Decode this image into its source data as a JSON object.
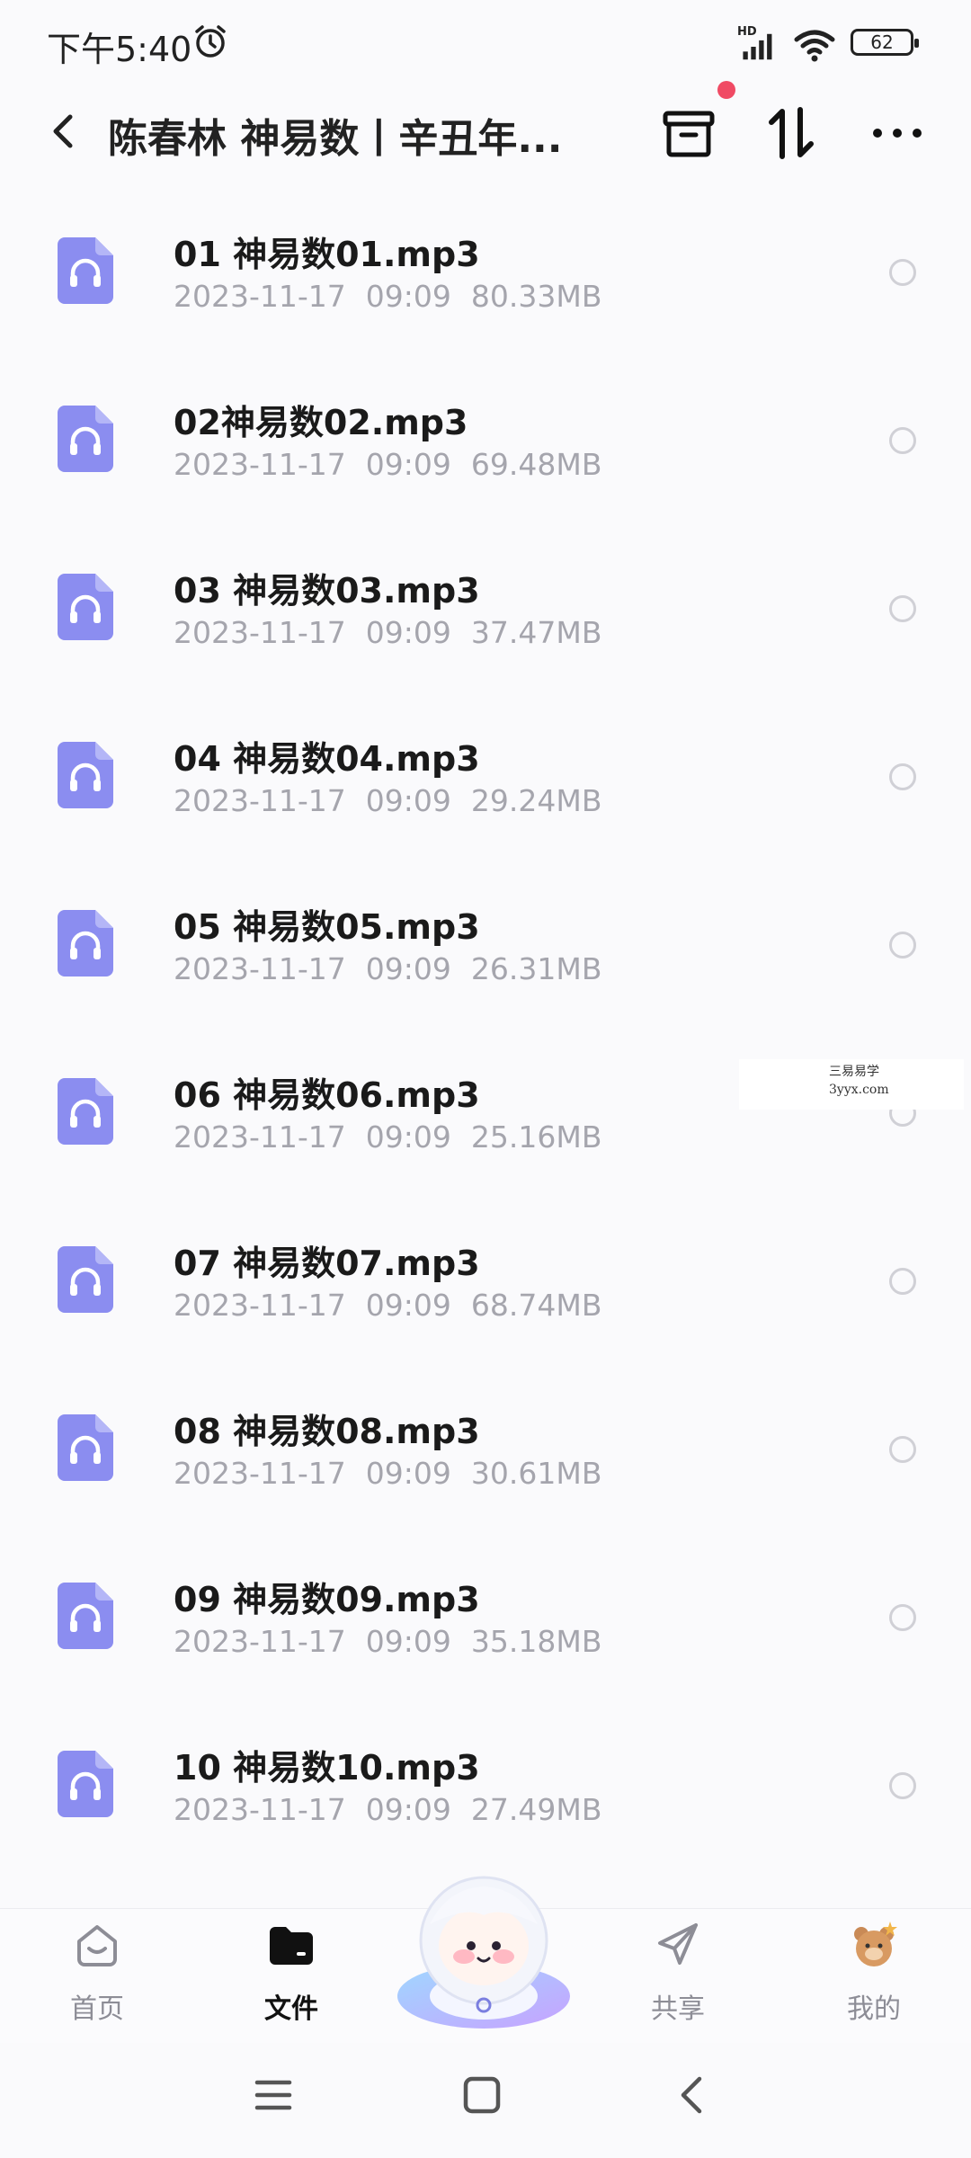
{
  "status": {
    "time": "下午5:40",
    "network": "HD",
    "battery": "62"
  },
  "header": {
    "title": "陈春林 神易数丨辛丑年..."
  },
  "files": [
    {
      "name": "01 神易数01.mp3",
      "date": "2023-11-17",
      "time": "09:09",
      "size": "80.33MB"
    },
    {
      "name": "02神易数02.mp3",
      "date": "2023-11-17",
      "time": "09:09",
      "size": "69.48MB"
    },
    {
      "name": "03 神易数03.mp3",
      "date": "2023-11-17",
      "time": "09:09",
      "size": "37.47MB"
    },
    {
      "name": "04 神易数04.mp3",
      "date": "2023-11-17",
      "time": "09:09",
      "size": "29.24MB"
    },
    {
      "name": "05 神易数05.mp3",
      "date": "2023-11-17",
      "time": "09:09",
      "size": "26.31MB"
    },
    {
      "name": "06 神易数06.mp3",
      "date": "2023-11-17",
      "time": "09:09",
      "size": "25.16MB"
    },
    {
      "name": "07 神易数07.mp3",
      "date": "2023-11-17",
      "time": "09:09",
      "size": "68.74MB"
    },
    {
      "name": "08 神易数08.mp3",
      "date": "2023-11-17",
      "time": "09:09",
      "size": "30.61MB"
    },
    {
      "name": "09 神易数09.mp3",
      "date": "2023-11-17",
      "time": "09:09",
      "size": "35.18MB"
    },
    {
      "name": "10 神易数10.mp3",
      "date": "2023-11-17",
      "time": "09:09",
      "size": "27.49MB"
    }
  ],
  "watermark": {
    "line1": "三易易学",
    "line2": "3yyx.com"
  },
  "nav": {
    "home": "首页",
    "files": "文件",
    "share": "共享",
    "mine": "我的"
  },
  "colors": {
    "file_icon": "#8b8df0",
    "accent_dot": "#f04a64",
    "meta_text": "#a5a5ad"
  }
}
